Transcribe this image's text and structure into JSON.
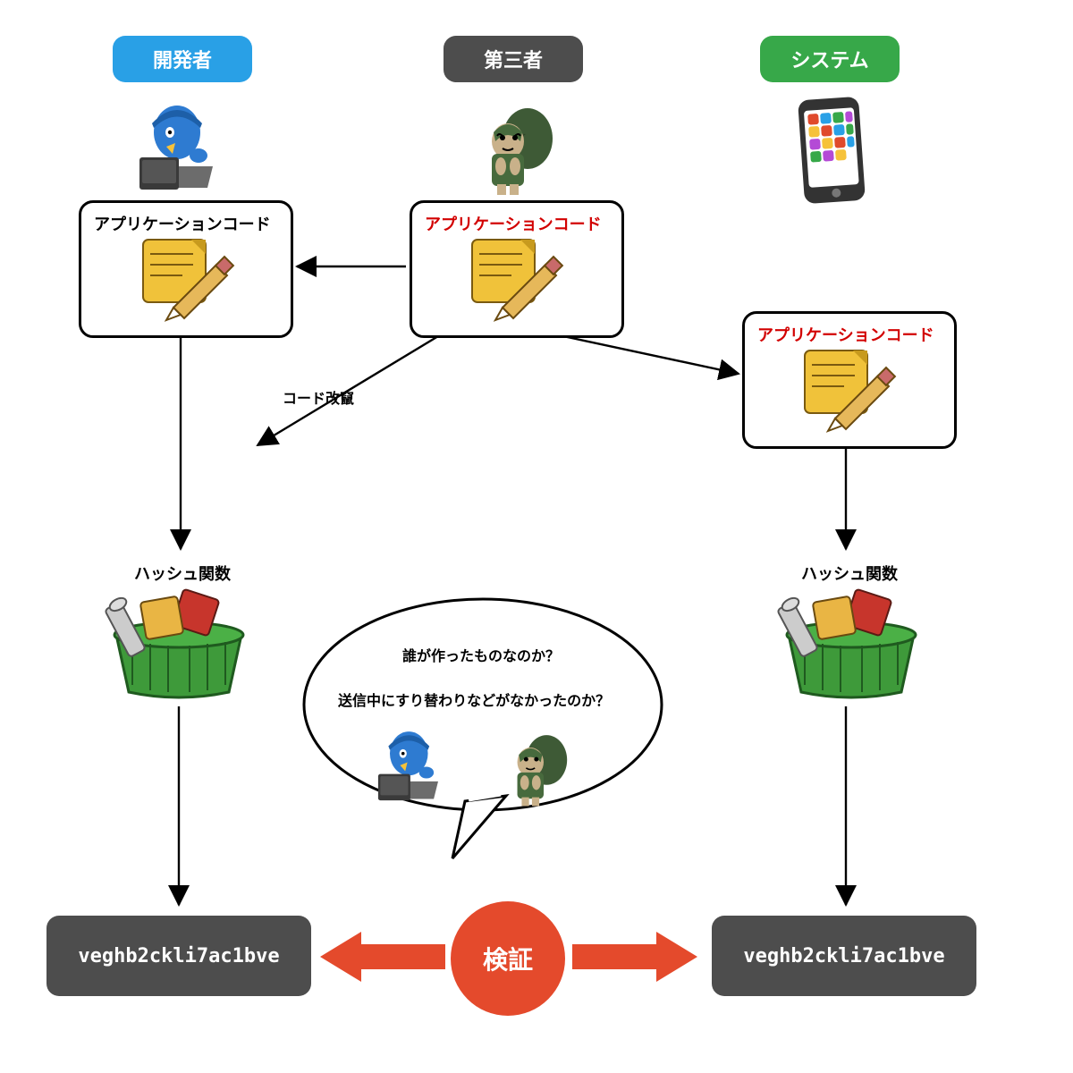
{
  "header": {
    "developer": "開発者",
    "thirdparty": "第三者",
    "system": "システム"
  },
  "box": {
    "dev_app": "アプリケーションコード",
    "tp_app": "アプリケーションコード",
    "sys_app": "アプリケーションコード",
    "hash_fn_left": "ハッシュ関数",
    "hash_fn_right": "ハッシュ関数"
  },
  "arrowlabel": {
    "tamper": "コード改竄"
  },
  "bubble": {
    "line1": "誰が作ったものなのか？",
    "line2": "送信中にすり替わりなどがなかったのか？"
  },
  "hash_left": "veghb2ckli7ac1bve",
  "hash_right": "veghb2ckli7ac1bve",
  "verify_label": "検証"
}
